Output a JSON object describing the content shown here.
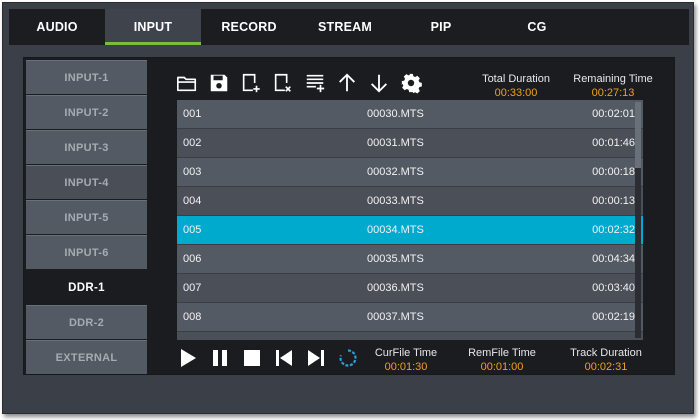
{
  "tabs": [
    {
      "label": "AUDIO",
      "active": false
    },
    {
      "label": "INPUT",
      "active": true
    },
    {
      "label": "RECORD",
      "active": false
    },
    {
      "label": "STREAM",
      "active": false
    },
    {
      "label": "PIP",
      "active": false
    },
    {
      "label": "CG",
      "active": false
    }
  ],
  "sidebar": {
    "items": [
      {
        "label": "INPUT-1"
      },
      {
        "label": "INPUT-2"
      },
      {
        "label": "INPUT-3"
      },
      {
        "label": "INPUT-4"
      },
      {
        "label": "INPUT-5"
      },
      {
        "label": "INPUT-6"
      },
      {
        "label": "DDR-1"
      },
      {
        "label": "DDR-2"
      },
      {
        "label": "EXTERNAL"
      }
    ],
    "active_index": 6
  },
  "toolbar": {
    "icons": [
      "folder-open-icon",
      "save-icon",
      "add-file-icon",
      "remove-file-icon",
      "add-list-icon",
      "arrow-up-icon",
      "arrow-down-icon",
      "gear-icon"
    ]
  },
  "stats": {
    "total_duration_label": "Total Duration",
    "total_duration_value": "00:33:00",
    "remaining_time_label": "Remaining Time",
    "remaining_time_value": "00:27:13"
  },
  "playlist": {
    "rows": [
      {
        "num": "001",
        "file": "00030.MTS",
        "duration": "00:02:01"
      },
      {
        "num": "002",
        "file": "00031.MTS",
        "duration": "00:01:46"
      },
      {
        "num": "003",
        "file": "00032.MTS",
        "duration": "00:00:18"
      },
      {
        "num": "004",
        "file": "00033.MTS",
        "duration": "00:00:13"
      },
      {
        "num": "005",
        "file": "00034.MTS",
        "duration": "00:02:32"
      },
      {
        "num": "006",
        "file": "00035.MTS",
        "duration": "00:04:34"
      },
      {
        "num": "007",
        "file": "00036.MTS",
        "duration": "00:03:40"
      },
      {
        "num": "008",
        "file": "00037.MTS",
        "duration": "00:02:19"
      }
    ],
    "selected_index": 4
  },
  "transport": {
    "icons": [
      "play-icon",
      "pause-icon",
      "stop-icon",
      "previous-icon",
      "next-icon",
      "loop-icon"
    ]
  },
  "timers": {
    "curfile_label": "CurFile Time",
    "curfile_value": "00:01:30",
    "remfile_label": "RemFile Time",
    "remfile_value": "00:01:00",
    "track_label": "Track Duration",
    "track_value": "00:02:31"
  },
  "colors": {
    "accent_green": "#7dbb3a",
    "selection_cyan": "#00aacc",
    "time_orange": "#f0a020",
    "loop_blue": "#2a9fd8"
  }
}
